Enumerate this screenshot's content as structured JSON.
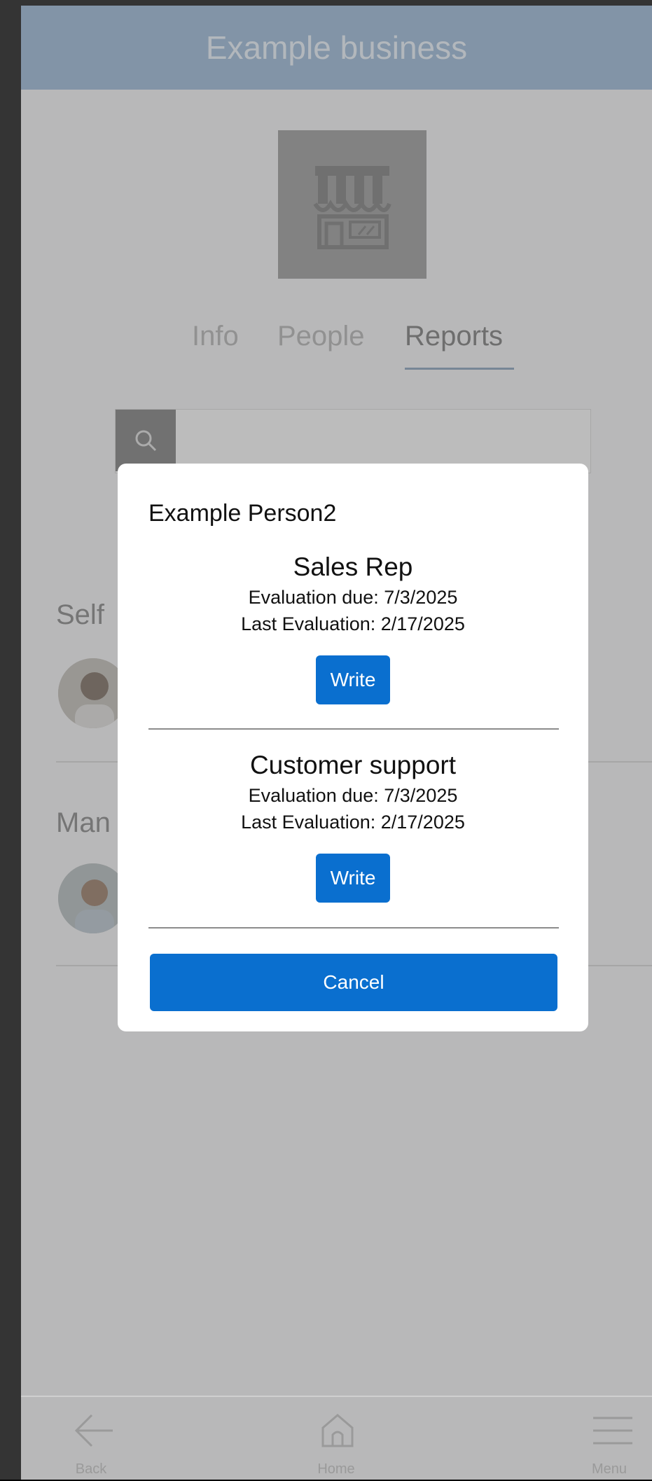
{
  "header": {
    "title": "Example business"
  },
  "tabs": [
    {
      "label": "Info"
    },
    {
      "label": "People"
    },
    {
      "label": "Reports"
    }
  ],
  "active_tab": "Reports",
  "sections": [
    {
      "label": "Self"
    },
    {
      "label": "Man"
    }
  ],
  "dialog": {
    "person_name": "Example Person2",
    "roles": [
      {
        "title": "Sales Rep",
        "evaluation_due": "Evaluation due: 7/3/2025",
        "last_evaluation": "Last Evaluation: 2/17/2025",
        "button_label": "Write"
      },
      {
        "title": "Customer support",
        "evaluation_due": "Evaluation due: 7/3/2025",
        "last_evaluation": "Last Evaluation: 2/17/2025",
        "button_label": "Write"
      }
    ],
    "cancel_label": "Cancel"
  },
  "bottom_nav": [
    {
      "label": "Back",
      "icon": "back-arrow-icon"
    },
    {
      "label": "Home",
      "icon": "home-icon"
    },
    {
      "label": "Menu",
      "icon": "hamburger-menu-icon"
    }
  ],
  "colors": {
    "header": "#8fb0d1",
    "primary_button": "#0a6fcf",
    "overlay": "rgba(115,115,115,0.45)"
  }
}
